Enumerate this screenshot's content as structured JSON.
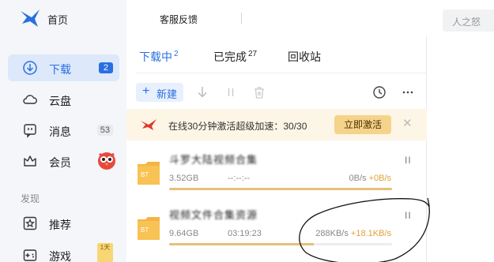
{
  "sidebar": {
    "home": "首页",
    "items": [
      {
        "label": "下载",
        "badge": "2"
      },
      {
        "label": "云盘"
      },
      {
        "label": "消息",
        "badge": "53"
      },
      {
        "label": "会员"
      }
    ],
    "section_title": "发现",
    "discover": [
      {
        "label": "推荐"
      },
      {
        "label": "游戏",
        "badge": "1天"
      }
    ]
  },
  "topbar": {
    "feedback": "客服反馈",
    "user": "人之怒"
  },
  "tabs": [
    {
      "label": "下载中",
      "count": "2"
    },
    {
      "label": "已完成",
      "count": "27"
    },
    {
      "label": "回收站",
      "count": ""
    }
  ],
  "toolbar": {
    "new_label": "新建"
  },
  "banner": {
    "text": "在线30分钟激活超级加速：30/30",
    "button": "立即激活",
    "close": "✕"
  },
  "downloads": [
    {
      "name": "斗罗大陆视频合集",
      "size": "3.52GB",
      "time": "--:--:--",
      "speed": "0B/s",
      "boost": "+0B/s",
      "progress": 1.0,
      "file_type": "BT"
    },
    {
      "name": "视频文件合集资源",
      "size": "9.64GB",
      "time": "03:19:23",
      "speed": "288KB/s",
      "boost": "+18.1KB/s",
      "progress": 0.65,
      "file_type": "BT"
    }
  ],
  "pause_label": "II",
  "colors": {
    "accent": "#2a6fe0",
    "active_bg": "#dde8fb",
    "banner_bg": "#fdf6e6",
    "progress": "#e5c07a",
    "boost": "#e0a13a"
  }
}
